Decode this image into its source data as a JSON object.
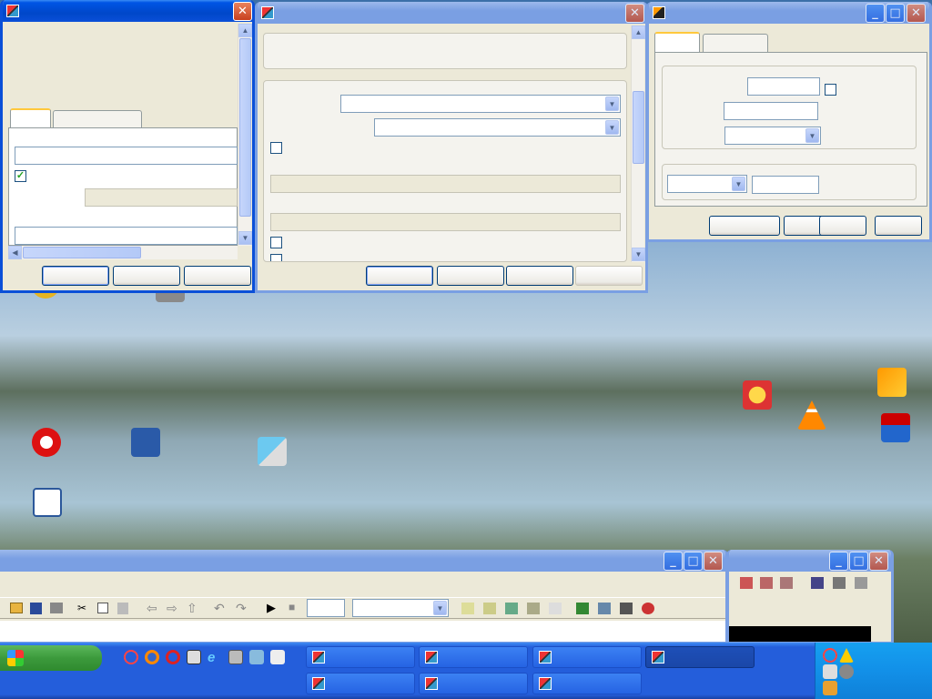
{
  "colors": {
    "xp_blue": "#0a4fd8",
    "face": "#ece9d8",
    "group_title": "#0046d5"
  },
  "desktop_icons": [
    {
      "label": "",
      "icon": "norton-icon"
    },
    {
      "label": "",
      "icon": "printer-icon"
    },
    {
      "label": "",
      "icon": "nero-icon"
    },
    {
      "label": "",
      "icon": "shortcut-icon"
    },
    {
      "label": "",
      "icon": "smarthru-icon"
    },
    {
      "label": "",
      "icon": "word-icon"
    },
    {
      "label": "",
      "icon": "cyberlink-icon"
    },
    {
      "label": "",
      "icon": "vlc-icon"
    },
    {
      "label": "",
      "icon": "winamp-icon"
    },
    {
      "label": "",
      "icon": "total-commander-icon"
    }
  ],
  "source_dialog": {
    "title": "",
    "section": "",
    "description": "",
    "tabs": [
      "",
      ""
    ],
    "constant_label": "",
    "constant_value": "",
    "interpret_label": "",
    "sampling_mode_label": "",
    "sampling_mode_value": "",
    "sample_time_label": "",
    "sample_time_value": "",
    "buttons": {
      "ok": "",
      "cancel": "",
      "help": ""
    }
  },
  "function_dialog": {
    "title": "",
    "group1_title": "",
    "group1_text": "",
    "group2_title": "",
    "external_reset_label": "",
    "external_reset_value": "",
    "initial_source_label": "",
    "initial_source_value": "",
    "limit_output_label": "",
    "upper_label": "",
    "upper_value": "",
    "lower_label": "",
    "lower_value": "",
    "show_sat_label": "",
    "show_state_label": "",
    "buttons": {
      "ok": "",
      "cancel": "",
      "help": "",
      "apply": ""
    }
  },
  "scope_dialog": {
    "title": "",
    "tabs": [
      "",
      ""
    ],
    "tip": "",
    "axes_title": "",
    "num_axes_label": "",
    "num_axes_value": "",
    "floating_label": "",
    "time_range_label": "",
    "time_range_value": "",
    "tick_labels_label": "",
    "tick_labels_value": "",
    "sampling_title": "",
    "sampling_mode_value": "",
    "sampling_value": "",
    "buttons": {
      "ok": "",
      "cancel": "",
      "help": "",
      "apply": ""
    }
  },
  "integrator_window": {
    "title": "",
    "menu": [
      "",
      "",
      "",
      "",
      "",
      ""
    ],
    "stop_time": "",
    "sim_mode": ""
  },
  "taskbar": {
    "start_label": "",
    "row1": [
      "",
      "",
      "",
      ""
    ],
    "row2": [
      "",
      "",
      ""
    ],
    "language": "",
    "time": "",
    "weekday": "",
    "date": ""
  }
}
